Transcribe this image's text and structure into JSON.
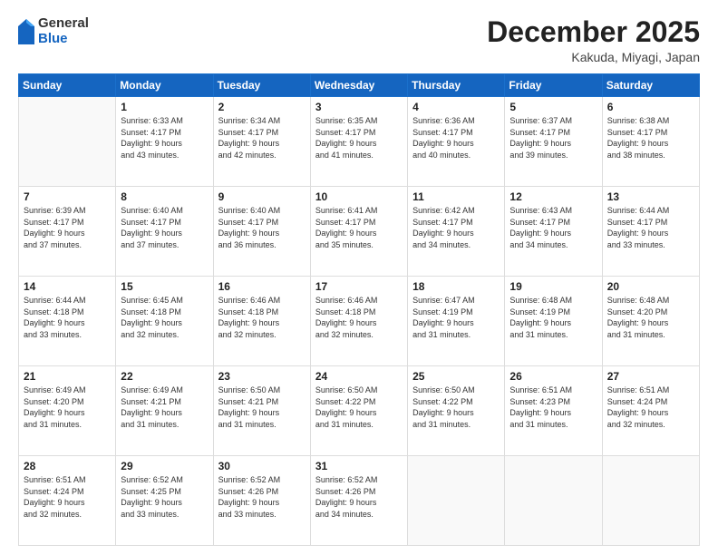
{
  "logo": {
    "general": "General",
    "blue": "Blue"
  },
  "header": {
    "month": "December 2025",
    "location": "Kakuda, Miyagi, Japan"
  },
  "weekdays": [
    "Sunday",
    "Monday",
    "Tuesday",
    "Wednesday",
    "Thursday",
    "Friday",
    "Saturday"
  ],
  "weeks": [
    [
      {
        "day": "",
        "sunrise": "",
        "sunset": "",
        "daylight": ""
      },
      {
        "day": "1",
        "sunrise": "Sunrise: 6:33 AM",
        "sunset": "Sunset: 4:17 PM",
        "daylight": "Daylight: 9 hours and 43 minutes."
      },
      {
        "day": "2",
        "sunrise": "Sunrise: 6:34 AM",
        "sunset": "Sunset: 4:17 PM",
        "daylight": "Daylight: 9 hours and 42 minutes."
      },
      {
        "day": "3",
        "sunrise": "Sunrise: 6:35 AM",
        "sunset": "Sunset: 4:17 PM",
        "daylight": "Daylight: 9 hours and 41 minutes."
      },
      {
        "day": "4",
        "sunrise": "Sunrise: 6:36 AM",
        "sunset": "Sunset: 4:17 PM",
        "daylight": "Daylight: 9 hours and 40 minutes."
      },
      {
        "day": "5",
        "sunrise": "Sunrise: 6:37 AM",
        "sunset": "Sunset: 4:17 PM",
        "daylight": "Daylight: 9 hours and 39 minutes."
      },
      {
        "day": "6",
        "sunrise": "Sunrise: 6:38 AM",
        "sunset": "Sunset: 4:17 PM",
        "daylight": "Daylight: 9 hours and 38 minutes."
      }
    ],
    [
      {
        "day": "7",
        "sunrise": "Sunrise: 6:39 AM",
        "sunset": "Sunset: 4:17 PM",
        "daylight": "Daylight: 9 hours and 37 minutes."
      },
      {
        "day": "8",
        "sunrise": "Sunrise: 6:40 AM",
        "sunset": "Sunset: 4:17 PM",
        "daylight": "Daylight: 9 hours and 37 minutes."
      },
      {
        "day": "9",
        "sunrise": "Sunrise: 6:40 AM",
        "sunset": "Sunset: 4:17 PM",
        "daylight": "Daylight: 9 hours and 36 minutes."
      },
      {
        "day": "10",
        "sunrise": "Sunrise: 6:41 AM",
        "sunset": "Sunset: 4:17 PM",
        "daylight": "Daylight: 9 hours and 35 minutes."
      },
      {
        "day": "11",
        "sunrise": "Sunrise: 6:42 AM",
        "sunset": "Sunset: 4:17 PM",
        "daylight": "Daylight: 9 hours and 34 minutes."
      },
      {
        "day": "12",
        "sunrise": "Sunrise: 6:43 AM",
        "sunset": "Sunset: 4:17 PM",
        "daylight": "Daylight: 9 hours and 34 minutes."
      },
      {
        "day": "13",
        "sunrise": "Sunrise: 6:44 AM",
        "sunset": "Sunset: 4:17 PM",
        "daylight": "Daylight: 9 hours and 33 minutes."
      }
    ],
    [
      {
        "day": "14",
        "sunrise": "Sunrise: 6:44 AM",
        "sunset": "Sunset: 4:18 PM",
        "daylight": "Daylight: 9 hours and 33 minutes."
      },
      {
        "day": "15",
        "sunrise": "Sunrise: 6:45 AM",
        "sunset": "Sunset: 4:18 PM",
        "daylight": "Daylight: 9 hours and 32 minutes."
      },
      {
        "day": "16",
        "sunrise": "Sunrise: 6:46 AM",
        "sunset": "Sunset: 4:18 PM",
        "daylight": "Daylight: 9 hours and 32 minutes."
      },
      {
        "day": "17",
        "sunrise": "Sunrise: 6:46 AM",
        "sunset": "Sunset: 4:18 PM",
        "daylight": "Daylight: 9 hours and 32 minutes."
      },
      {
        "day": "18",
        "sunrise": "Sunrise: 6:47 AM",
        "sunset": "Sunset: 4:19 PM",
        "daylight": "Daylight: 9 hours and 31 minutes."
      },
      {
        "day": "19",
        "sunrise": "Sunrise: 6:48 AM",
        "sunset": "Sunset: 4:19 PM",
        "daylight": "Daylight: 9 hours and 31 minutes."
      },
      {
        "day": "20",
        "sunrise": "Sunrise: 6:48 AM",
        "sunset": "Sunset: 4:20 PM",
        "daylight": "Daylight: 9 hours and 31 minutes."
      }
    ],
    [
      {
        "day": "21",
        "sunrise": "Sunrise: 6:49 AM",
        "sunset": "Sunset: 4:20 PM",
        "daylight": "Daylight: 9 hours and 31 minutes."
      },
      {
        "day": "22",
        "sunrise": "Sunrise: 6:49 AM",
        "sunset": "Sunset: 4:21 PM",
        "daylight": "Daylight: 9 hours and 31 minutes."
      },
      {
        "day": "23",
        "sunrise": "Sunrise: 6:50 AM",
        "sunset": "Sunset: 4:21 PM",
        "daylight": "Daylight: 9 hours and 31 minutes."
      },
      {
        "day": "24",
        "sunrise": "Sunrise: 6:50 AM",
        "sunset": "Sunset: 4:22 PM",
        "daylight": "Daylight: 9 hours and 31 minutes."
      },
      {
        "day": "25",
        "sunrise": "Sunrise: 6:50 AM",
        "sunset": "Sunset: 4:22 PM",
        "daylight": "Daylight: 9 hours and 31 minutes."
      },
      {
        "day": "26",
        "sunrise": "Sunrise: 6:51 AM",
        "sunset": "Sunset: 4:23 PM",
        "daylight": "Daylight: 9 hours and 31 minutes."
      },
      {
        "day": "27",
        "sunrise": "Sunrise: 6:51 AM",
        "sunset": "Sunset: 4:24 PM",
        "daylight": "Daylight: 9 hours and 32 minutes."
      }
    ],
    [
      {
        "day": "28",
        "sunrise": "Sunrise: 6:51 AM",
        "sunset": "Sunset: 4:24 PM",
        "daylight": "Daylight: 9 hours and 32 minutes."
      },
      {
        "day": "29",
        "sunrise": "Sunrise: 6:52 AM",
        "sunset": "Sunset: 4:25 PM",
        "daylight": "Daylight: 9 hours and 33 minutes."
      },
      {
        "day": "30",
        "sunrise": "Sunrise: 6:52 AM",
        "sunset": "Sunset: 4:26 PM",
        "daylight": "Daylight: 9 hours and 33 minutes."
      },
      {
        "day": "31",
        "sunrise": "Sunrise: 6:52 AM",
        "sunset": "Sunset: 4:26 PM",
        "daylight": "Daylight: 9 hours and 34 minutes."
      },
      {
        "day": "",
        "sunrise": "",
        "sunset": "",
        "daylight": ""
      },
      {
        "day": "",
        "sunrise": "",
        "sunset": "",
        "daylight": ""
      },
      {
        "day": "",
        "sunrise": "",
        "sunset": "",
        "daylight": ""
      }
    ]
  ]
}
